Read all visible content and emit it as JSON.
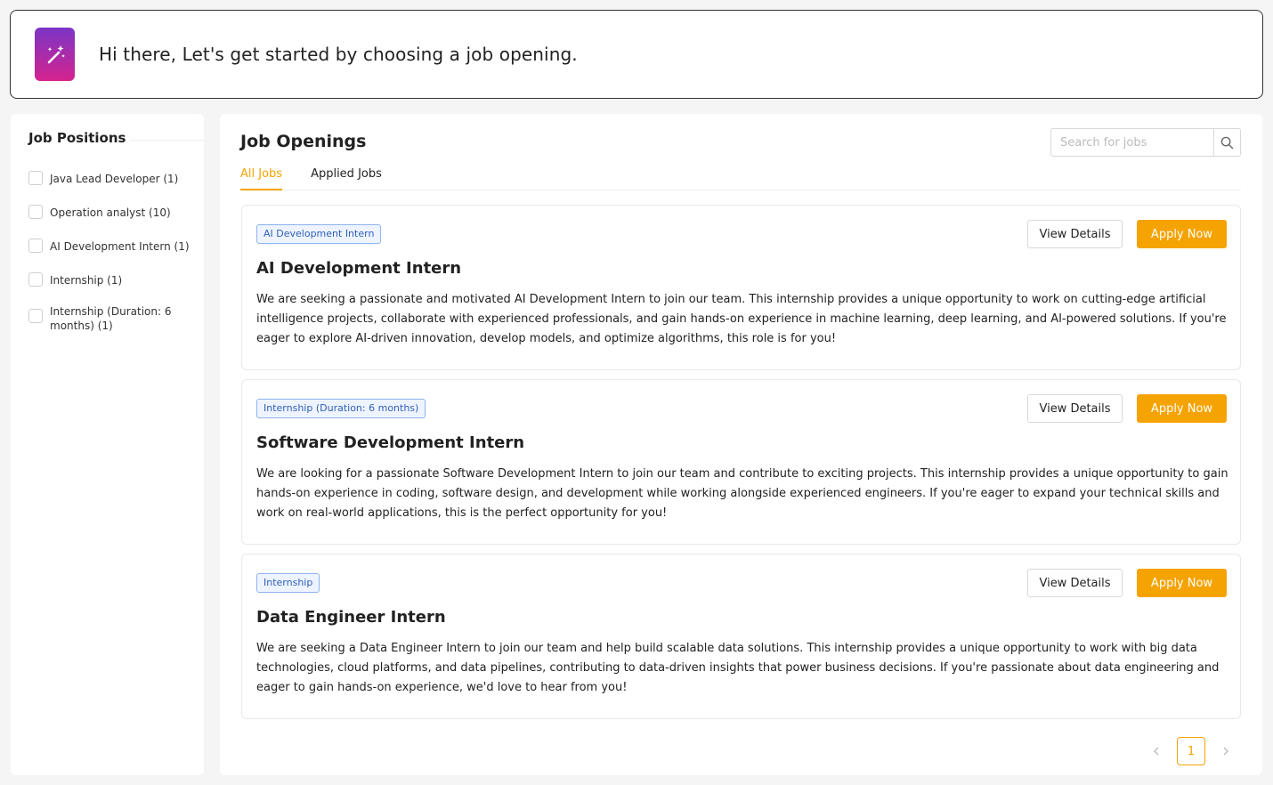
{
  "banner": {
    "text": "Hi there, Let's get started by choosing a job opening.",
    "logo_icon": "magic-wand-document-icon"
  },
  "sidebar": {
    "title": "Job Positions",
    "filters": [
      {
        "label": "Java Lead Developer (1)",
        "checked": false
      },
      {
        "label": "Operation analyst (10)",
        "checked": false
      },
      {
        "label": "AI Development Intern (1)",
        "checked": false
      },
      {
        "label": "Internship (1)",
        "checked": false
      },
      {
        "label": "Internship (Duration: 6 months) (1)",
        "checked": false
      }
    ]
  },
  "main": {
    "title": "Job Openings",
    "search": {
      "placeholder": "Search for jobs",
      "value": ""
    },
    "tabs": [
      {
        "label": "All Jobs",
        "active": true
      },
      {
        "label": "Applied Jobs",
        "active": false
      }
    ],
    "jobs": [
      {
        "tag": "AI Development Intern",
        "title": "AI Development Intern",
        "description": "We are seeking a passionate and motivated AI Development Intern to join our team. This internship provides a unique opportunity to work on cutting-edge artificial intelligence projects, collaborate with experienced professionals, and gain hands-on experience in machine learning, deep learning, and AI-powered solutions. If you're eager to explore AI-driven innovation, develop models, and optimize algorithms, this role is for you!",
        "details_label": "View Details",
        "apply_label": "Apply Now"
      },
      {
        "tag": "Internship (Duration: 6 months)",
        "title": "Software Development Intern",
        "description": "We are looking for a passionate Software Development Intern to join our team and contribute to exciting projects. This internship provides a unique opportunity to gain hands-on experience in coding, software design, and development while working alongside experienced engineers. If you're eager to expand your technical skills and work on real-world applications, this is the perfect opportunity for you!",
        "details_label": "View Details",
        "apply_label": "Apply Now"
      },
      {
        "tag": "Internship",
        "title": "Data Engineer Intern",
        "description": "We are seeking a Data Engineer Intern to join our team and help build scalable data solutions. This internship provides a unique opportunity to work with big data technologies, cloud platforms, and data pipelines, contributing to data-driven insights that power business decisions. If you're passionate about data engineering and eager to gain hands-on experience, we'd love to hear from you!",
        "details_label": "View Details",
        "apply_label": "Apply Now"
      }
    ],
    "pagination": {
      "current_page": "1"
    }
  },
  "colors": {
    "accent": "#f5a300",
    "tag_border": "#8fb4ef",
    "tag_text": "#2f5fb8",
    "logo_gradient_top": "#7b35c6",
    "logo_gradient_bottom": "#d5238e"
  }
}
